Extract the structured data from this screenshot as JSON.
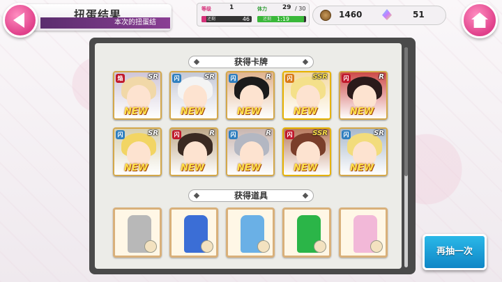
{
  "header": {
    "title": "扭蛋结果",
    "subtitle": "本次的扭蛋结"
  },
  "status": {
    "rank_label": "等级",
    "rank_value": "1",
    "exp_remaining_label": "还剩",
    "exp_remaining": "46",
    "stamina_label": "体力",
    "stamina_value": "29",
    "stamina_max": "/ 30",
    "stamina_timer_label": "还剩",
    "stamina_timer": "1:19"
  },
  "currency": {
    "coins": "1460",
    "gems": "51"
  },
  "sections": {
    "cards_title": "获得卡牌",
    "items_title": "获得道具"
  },
  "cards": [
    {
      "rarity": "SR",
      "type": "焔",
      "new": "NEW",
      "hair": "#f1d8a8",
      "bg": "#cfc6d8",
      "type_color": "#c0182c"
    },
    {
      "rarity": "SR",
      "type": "闪",
      "new": "NEW",
      "hair": "#f4f4f4",
      "bg": "#c5c8d6",
      "type_color": "#2f7fbf"
    },
    {
      "rarity": "R",
      "type": "闪",
      "new": "NEW",
      "hair": "#1b1b1b",
      "bg": "#e0b48f",
      "type_color": "#2f7fbf"
    },
    {
      "rarity": "SSR",
      "type": "闪",
      "new": "NEW",
      "hair": "#f4e08a",
      "bg": "#f3d9a2",
      "type_color": "#d97a1a"
    },
    {
      "rarity": "R",
      "type": "闪",
      "new": "NEW",
      "hair": "#2a1a1a",
      "bg": "#cc4a48",
      "type_color": "#c0182c"
    },
    {
      "rarity": "SR",
      "type": "闪",
      "new": "NEW",
      "hair": "#f2d564",
      "bg": "#d7d0b2",
      "type_color": "#2f7fbf"
    },
    {
      "rarity": "R",
      "type": "闪",
      "new": "NEW",
      "hair": "#3a2a22",
      "bg": "#bfa98a",
      "type_color": "#c0182c"
    },
    {
      "rarity": "R",
      "type": "闪",
      "new": "NEW",
      "hair": "#b3b7c2",
      "bg": "#c9b6b0",
      "type_color": "#2f7fbf"
    },
    {
      "rarity": "SSR",
      "type": "闪",
      "new": "NEW",
      "hair": "#7a3e2a",
      "bg": "#b87b5e",
      "type_color": "#c0182c"
    },
    {
      "rarity": "SR",
      "type": "闪",
      "new": "NEW",
      "hair": "#f2dc7c",
      "bg": "#a8b8cc",
      "type_color": "#2f7fbf"
    }
  ],
  "items": [
    {
      "outfit_color": "#b8b8b8"
    },
    {
      "outfit_color": "#3b6ed6"
    },
    {
      "outfit_color": "#6ab0e6"
    },
    {
      "outfit_color": "#2bb548"
    },
    {
      "outfit_color": "#f2b8d8"
    }
  ],
  "buttons": {
    "redraw": "再抽一次"
  }
}
